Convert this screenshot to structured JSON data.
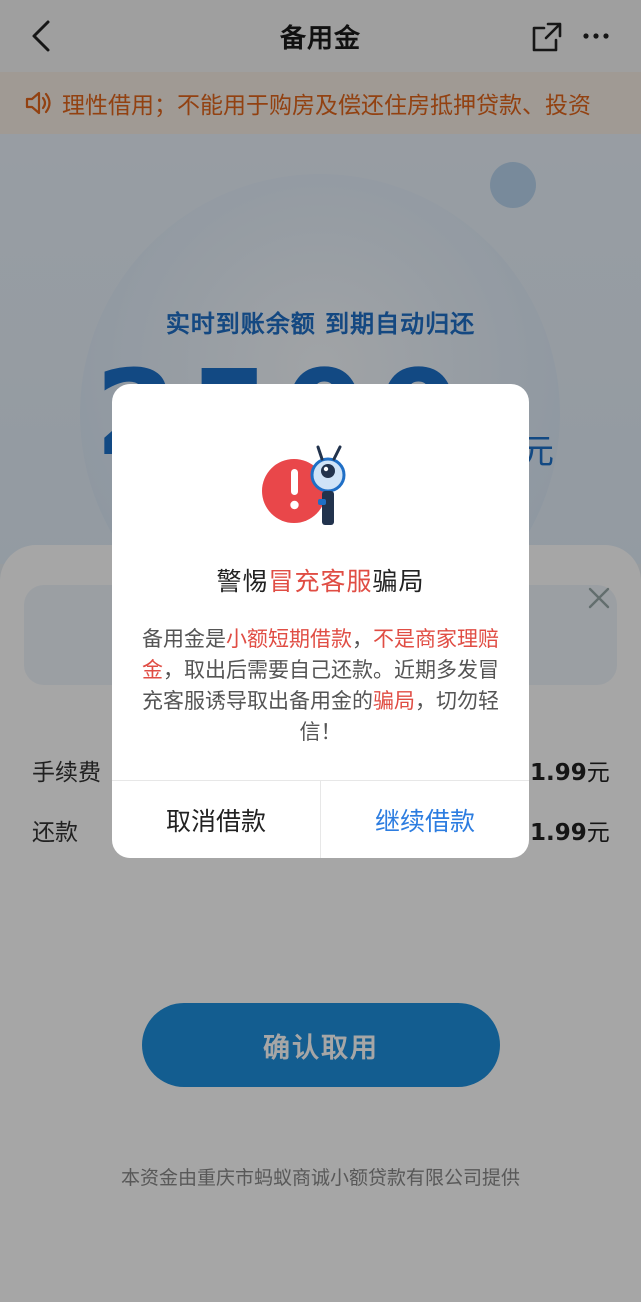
{
  "header": {
    "title": "备用金",
    "back_icon": "chevron-left-icon",
    "share_icon": "share-icon",
    "more_icon": "more-icon"
  },
  "notice": {
    "icon": "speaker-icon",
    "text": "理性借用；不能用于购房及偿还住房抵押贷款、投资"
  },
  "hero": {
    "subtitle": "实时到账余额 到期自动归还",
    "amount": "2500",
    "unit": "元"
  },
  "sheet": {
    "rows": [
      {
        "label": "手续费",
        "value": "1.99",
        "unit": "元"
      },
      {
        "label": "还款",
        "value": "1.99",
        "unit": "元"
      }
    ],
    "confirm_label": "确认取用",
    "footer": "本资金由重庆市蚂蚁商诚小额贷款有限公司提供"
  },
  "dialog": {
    "title_pre": "警惕",
    "title_highlight": "冒充客服",
    "title_post": "骗局",
    "body": [
      {
        "text": "备用金是",
        "highlight": false
      },
      {
        "text": "小额短期借款",
        "highlight": true
      },
      {
        "text": "，",
        "highlight": false
      },
      {
        "text": "不是商家理赔金",
        "highlight": true
      },
      {
        "text": "，取出后需要自己还款。近期多发冒充客服诱导取出备用金的",
        "highlight": false
      },
      {
        "text": "骗局",
        "highlight": true
      },
      {
        "text": "，切勿轻信！",
        "highlight": false
      }
    ],
    "cancel_label": "取消借款",
    "continue_label": "继续借款"
  },
  "colors": {
    "accent": "#2d7de0",
    "warning_red": "#e04d44",
    "notice_orange": "#e0651b"
  }
}
